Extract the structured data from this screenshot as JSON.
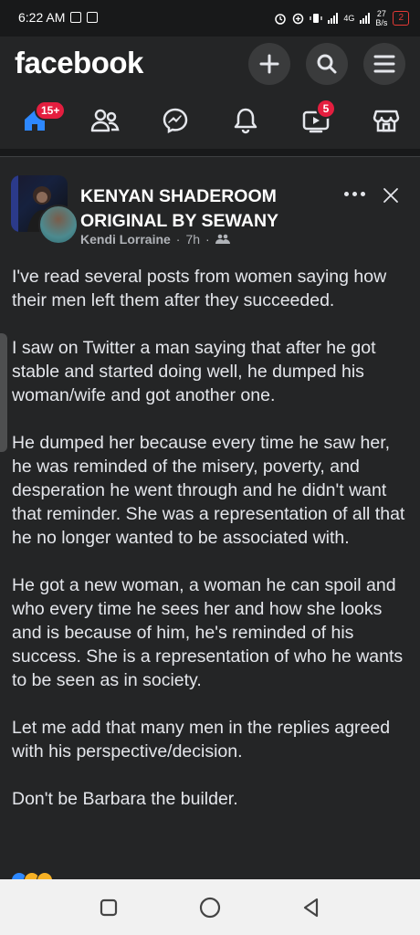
{
  "status_bar": {
    "time": "6:22 AM",
    "network_type": "4G",
    "speed_value": "27",
    "speed_unit": "B/s",
    "battery": "2"
  },
  "header": {
    "logo": "facebook",
    "nav": {
      "home_badge": "15+",
      "video_badge": "5"
    }
  },
  "post": {
    "page_name": "KENYAN SHADEROOM ORIGINAL BY SEWANY",
    "author": "Kendi Lorraine",
    "time": "7h",
    "paragraphs": [
      "I've read several posts from women saying how their men left them after they succeeded.",
      "I saw on Twitter a man saying that after he got stable and started doing well, he dumped his woman/wife and got another one.",
      "He dumped her because every time he saw her, he was reminded of the misery, poverty, and desperation he went through and he didn't want that reminder. She was a representation of all that he no longer wanted to be associated with.",
      "He got a new woman, a woman he can spoil and who every time he sees her and how she looks and is because of him, he's reminded of his success. She is a representation of who he wants to be seen as in society.",
      "Let me add that many men in the replies agreed with his perspective/decision.",
      "Don't be Barbara the builder."
    ]
  },
  "colors": {
    "background": "#242526",
    "badge": "#e41e3f",
    "active_blue": "#2d88ff"
  }
}
